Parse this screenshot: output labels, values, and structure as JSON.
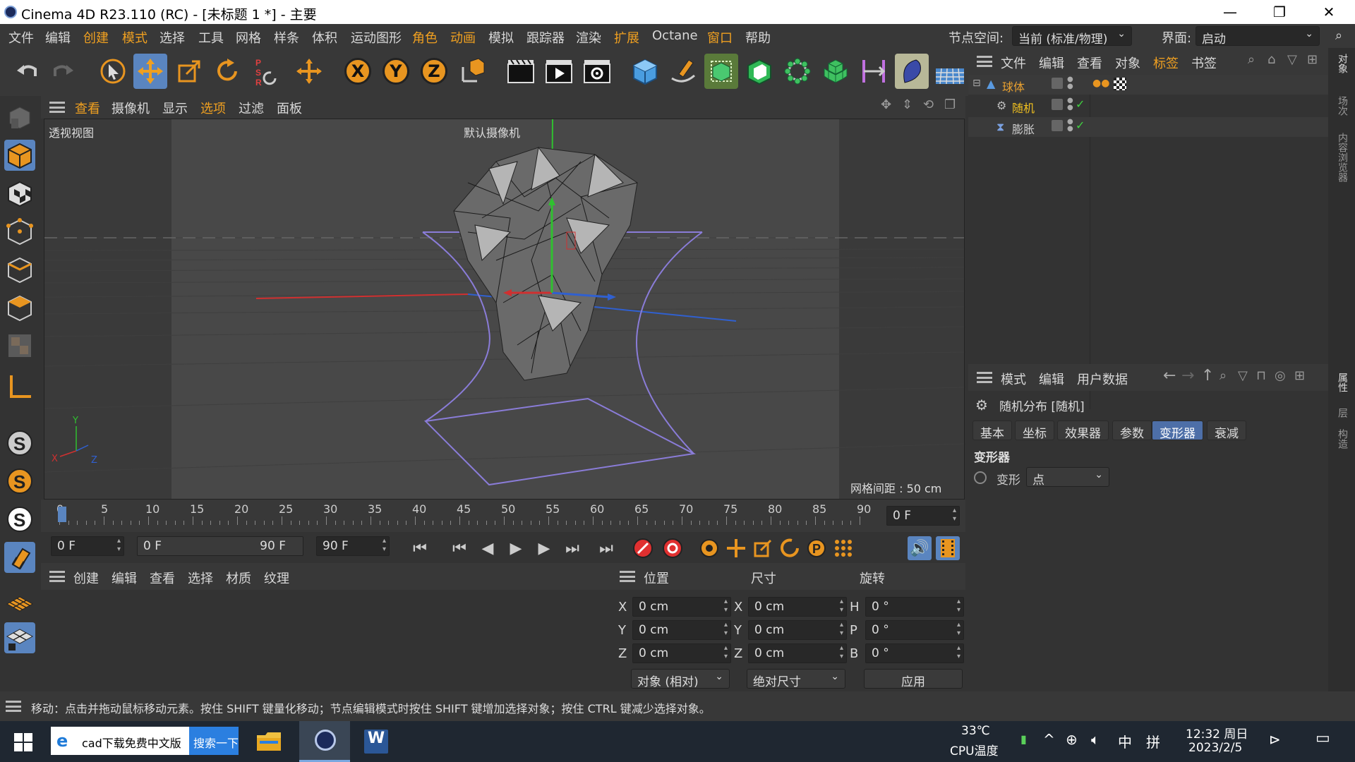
{
  "window": {
    "title": "Cinema 4D R23.110 (RC) - [未标题 1 *] - 主要",
    "min": "—",
    "max": "❐",
    "close": "✕"
  },
  "menu": [
    "文件",
    "编辑",
    "创建",
    "模式",
    "选择",
    "工具",
    "网格",
    "样条",
    "体积",
    "运动图形",
    "角色",
    "动画",
    "模拟",
    "跟踪器",
    "渲染",
    "扩展",
    "Octane",
    "窗口",
    "帮助"
  ],
  "node_space": {
    "label": "节点空间:",
    "value": "当前 (标准/物理)"
  },
  "layout": {
    "label": "界面:",
    "value": "启动"
  },
  "viewport": {
    "menu": [
      "查看",
      "摄像机",
      "显示",
      "选项",
      "过滤",
      "面板"
    ],
    "view_name": "透视视图",
    "camera": "默认摄像机",
    "grid": "网格间距 : 50 cm",
    "axis_x": "X",
    "axis_y": "Y",
    "axis_z": "Z"
  },
  "timeline": {
    "ticks": [
      "0",
      "5",
      "10",
      "15",
      "20",
      "25",
      "30",
      "35",
      "40",
      "45",
      "50",
      "55",
      "60",
      "65",
      "70",
      "75",
      "80",
      "85",
      "90"
    ],
    "current": "0 F",
    "start": "0 F",
    "range_start": "0 F",
    "range_end": "90 F",
    "end": "90 F"
  },
  "material_menu": [
    "创建",
    "编辑",
    "查看",
    "选择",
    "材质",
    "纹理"
  ],
  "coords": {
    "headers": [
      "位置",
      "尺寸",
      "旋转"
    ],
    "rows": [
      {
        "a": "X",
        "pos": "0 cm",
        "b": "X",
        "size": "0 cm",
        "c": "H",
        "rot": "0 °"
      },
      {
        "a": "Y",
        "pos": "0 cm",
        "b": "Y",
        "size": "0 cm",
        "c": "P",
        "rot": "0 °"
      },
      {
        "a": "Z",
        "pos": "0 cm",
        "b": "Z",
        "size": "0 cm",
        "c": "B",
        "rot": "0 °"
      }
    ],
    "mode": "对象 (相对)",
    "size_mode": "绝对尺寸",
    "apply": "应用"
  },
  "objects": {
    "menu": [
      "文件",
      "编辑",
      "查看",
      "对象",
      "标签",
      "书签"
    ],
    "items": [
      {
        "name": "球体",
        "color": "#e8a030"
      },
      {
        "name": "随机",
        "color": "#f0c020"
      },
      {
        "name": "膨胀",
        "color": "#cccccc"
      }
    ]
  },
  "attributes": {
    "menu": [
      "模式",
      "编辑",
      "用户数据"
    ],
    "title": "随机分布 [随机]",
    "tabs": [
      "基本",
      "坐标",
      "效果器",
      "参数",
      "变形器",
      "衰减"
    ],
    "active_tab": "变形器",
    "section": "变形器",
    "field_label": "变形",
    "field_value": "点"
  },
  "right_strip": [
    "对象",
    "场次",
    "内容浏览器",
    "属性",
    "层",
    "构造"
  ],
  "status": "移动：点击并拖动鼠标移动元素。按住 SHIFT 键量化移动；节点编辑模式时按住 SHIFT 键增加选择对象；按住 CTRL 键减少选择对象。",
  "taskbar": {
    "search_text": "cad下载免费中文版",
    "search_btn": "搜索一下",
    "temp": "33℃",
    "temp_label": "CPU温度",
    "ime": "中",
    "time": "12:32 周日",
    "date": "2023/2/5"
  },
  "colors": {
    "accent": "#f0a020",
    "select": "#5a85c0"
  }
}
